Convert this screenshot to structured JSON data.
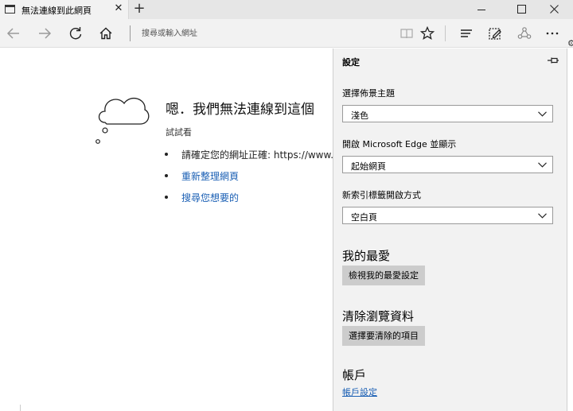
{
  "tab": {
    "title": "無法連線到此網頁",
    "close_glyph": "✕",
    "new_tab_glyph": "+"
  },
  "toolbar": {
    "address_placeholder": "搜尋或輸入網址",
    "overflow_glyph": "⚙"
  },
  "error_page": {
    "title": "嗯．我們無法連線到這個",
    "subtitle": "試試看",
    "items": [
      {
        "text": "請確定您的網址正確: https://www.",
        "link": false
      },
      {
        "text": "重新整理網頁",
        "link": true
      },
      {
        "text": "搜尋您想要的",
        "link": true
      }
    ]
  },
  "settings": {
    "title": "設定",
    "theme": {
      "label": "選擇佈景主題",
      "value": "淺色"
    },
    "open_with": {
      "label": "開啟 Microsoft Edge 並顯示",
      "value": "起始網頁"
    },
    "new_tab": {
      "label": "新索引標籤開啟方式",
      "value": "空白頁"
    },
    "favorites": {
      "heading": "我的最愛",
      "button": "檢視我的最愛設定"
    },
    "clear": {
      "heading": "清除瀏覽資料",
      "button": "選擇要清除的項目"
    },
    "account": {
      "heading": "帳戶",
      "link": "帳戶設定"
    }
  },
  "colors": {
    "link": "#1a5fb4",
    "panel_bg": "#f2f2f2",
    "button_bg": "#cccccc"
  }
}
